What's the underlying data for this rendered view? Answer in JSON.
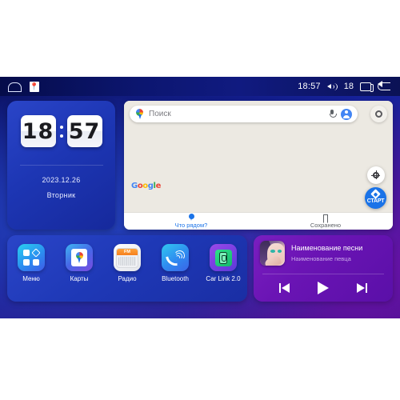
{
  "status_bar": {
    "home_icon": "home-icon",
    "notification_icon": "google-maps-notification-icon",
    "time": "18:57",
    "volume_icon": "speaker-volume-icon",
    "volume_level": "18",
    "recents_icon": "recent-apps-icon",
    "back_icon": "back-arrow-icon"
  },
  "clock_widget": {
    "hours": "18",
    "minutes": "57",
    "date": "2023.12.26",
    "weekday": "Вторник"
  },
  "map_widget": {
    "search_placeholder": "Поиск",
    "search_value": "",
    "pin_icon": "google-maps-pin-icon",
    "mic_icon": "microphone-icon",
    "avatar_icon": "account-avatar-icon",
    "layers_icon": "map-layers-icon",
    "brand": "Google",
    "brand_letters": [
      "G",
      "o",
      "o",
      "g",
      "l",
      "e"
    ],
    "my_location_icon": "my-location-icon",
    "start_button_label": "СТАРТ",
    "start_button_icon": "navigation-diamond-icon",
    "tabs": [
      {
        "label": "Что рядом?",
        "icon": "pin-icon",
        "active": true
      },
      {
        "label": "Сохранено",
        "icon": "bookmark-icon",
        "active": false
      }
    ]
  },
  "app_dock": {
    "apps": [
      {
        "label": "Меню",
        "icon": "menu-grid-icon"
      },
      {
        "label": "Карты",
        "icon": "maps-icon"
      },
      {
        "label": "Радио",
        "icon": "radio-icon",
        "badge": "FM"
      },
      {
        "label": "Bluetooth",
        "icon": "bluetooth-phone-icon"
      },
      {
        "label": "Car Link 2.0",
        "icon": "car-link-icon"
      }
    ]
  },
  "music_widget": {
    "album_art_icon": "album-art-portrait",
    "track_title": "Наименование песни",
    "artist": "Наименование певца",
    "prev_icon": "previous-track-icon",
    "play_icon": "play-icon",
    "next_icon": "next-track-icon"
  },
  "colors": {
    "background_blue": "#16229c",
    "background_purple": "#3c0f80",
    "widget_blue": "#2a45c8",
    "music_purple": "#6a14b4",
    "map_beige": "#ece9e2",
    "google_blue": "#1a73e8",
    "accent_orange": "#f5801e",
    "accent_green": "#14b86a"
  }
}
